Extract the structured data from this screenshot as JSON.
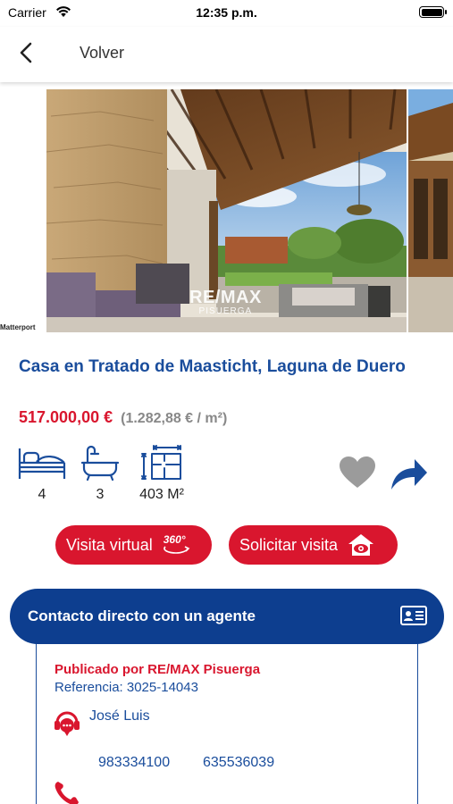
{
  "status_bar": {
    "carrier": "Carrier",
    "time": "12:35 p.m."
  },
  "nav": {
    "back_label": "Volver"
  },
  "gallery": {
    "provider_label": "Matterport",
    "watermark_brand": "RE/MAX",
    "watermark_office": "PISUERGA"
  },
  "listing": {
    "title": "Casa en Tratado de Maasticht, Laguna de Duero",
    "price": "517.000,00 €",
    "price_per_m2": "(1.282,88 € / m²)",
    "features": {
      "bedrooms": "4",
      "bathrooms": "3",
      "area": "403 M²"
    }
  },
  "actions": {
    "virtual_visit_label": "Visita virtual",
    "virtual_visit_badge": "360°",
    "request_visit_label": "Solicitar visita"
  },
  "contact": {
    "header": "Contacto directo con un agente",
    "published_by": "Publicado por RE/MAX Pisuerga",
    "reference": "Referencia: 3025-14043",
    "agent_name": "José Luis",
    "phones": [
      "983334100",
      "635536039"
    ]
  },
  "colors": {
    "brand_blue": "#0d3e8f",
    "brand_red": "#d9162e",
    "text_blue": "#1a4d9c"
  }
}
